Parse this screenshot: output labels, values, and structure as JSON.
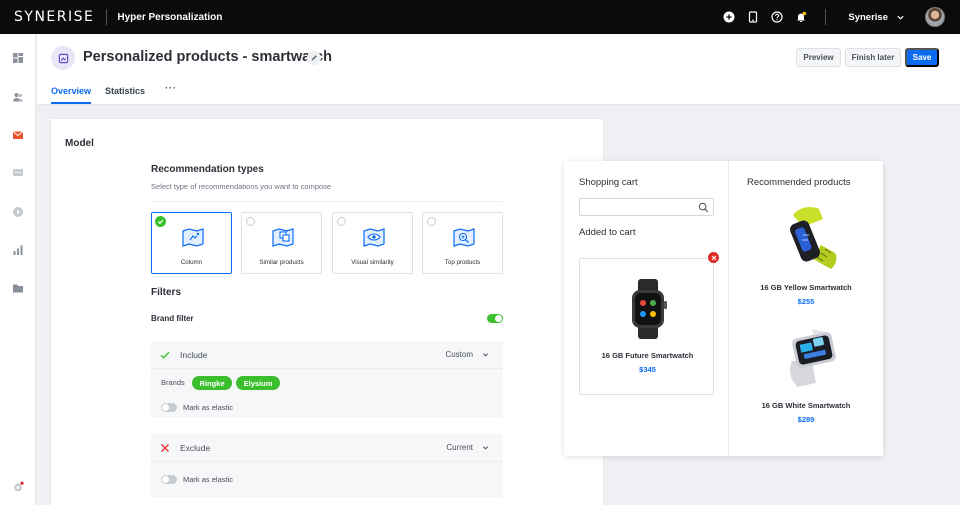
{
  "topbar": {
    "logo": "SYNERISE",
    "app_title": "Hyper Personalization",
    "workspace": "Synerise"
  },
  "header": {
    "title": "Personalized products - smartwatch",
    "buttons": {
      "preview": "Preview",
      "finish_later": "Finish later",
      "save": "Save"
    },
    "tabs": [
      {
        "label": "Overview",
        "active": true
      },
      {
        "label": "Statistics",
        "active": false
      }
    ],
    "more": "···"
  },
  "model": {
    "title": "Model",
    "rec_types_title": "Recommendation types",
    "rec_types_sub": "Select type of recommendations you want to compose",
    "rec_types": [
      {
        "label": "Column",
        "selected": true
      },
      {
        "label": "Similar products",
        "selected": false
      },
      {
        "label": "Visual similarity",
        "selected": false
      },
      {
        "label": "Top products",
        "selected": false
      }
    ],
    "filters_title": "Filters",
    "brand_filter_label": "Brand filter",
    "brand_filter_enabled": true,
    "include": {
      "label": "Include",
      "select": "Custom",
      "brands_label": "Brands",
      "brands": [
        "Ringke",
        "Elysium"
      ],
      "elastic_label": "Mark as elastic"
    },
    "exclude": {
      "label": "Exclude",
      "select": "Current",
      "elastic_label": "Mark as elastic"
    }
  },
  "preview": {
    "shopping_cart": "Shopping cart",
    "added_to_cart": "Added to cart",
    "recommended_products": "Recommended products",
    "cart_item": {
      "name": "16 GB Future Smartwatch",
      "price": "$345"
    },
    "recommended": [
      {
        "name": "16 GB Yellow Smartwatch",
        "price": "$255"
      },
      {
        "name": "16 GB White Smartwatch",
        "price": "$289"
      }
    ]
  },
  "colors": {
    "accent": "#0b6cf2",
    "success": "#3bbf2c",
    "danger": "#e02a2a",
    "topbar": "#0b0b0b"
  }
}
